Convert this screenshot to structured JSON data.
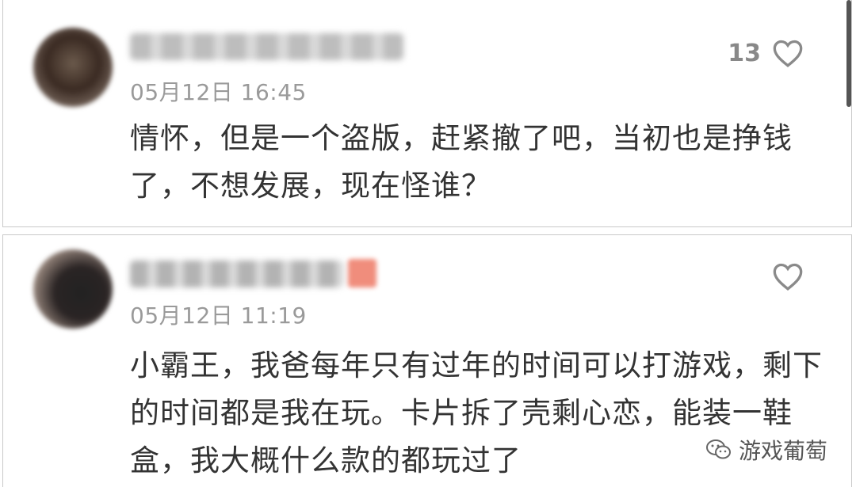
{
  "comments": [
    {
      "timestamp": "05月12日 16:45",
      "likes": "13",
      "text": "情怀，但是一个盗版，赶紧撤了吧，当初也是挣钱了，不想发展，现在怪谁？"
    },
    {
      "timestamp": "05月12日 11:19",
      "likes": "",
      "text": "小霸王，我爸每年只有过年的时间可以打游戏，剩下的时间都是我在玩。卡片拆了壳剩心恋，能装一鞋盒，我大概什么款的都玩过了"
    }
  ],
  "watermark": {
    "label": "游戏葡萄",
    "icon": "wechat-icon"
  }
}
